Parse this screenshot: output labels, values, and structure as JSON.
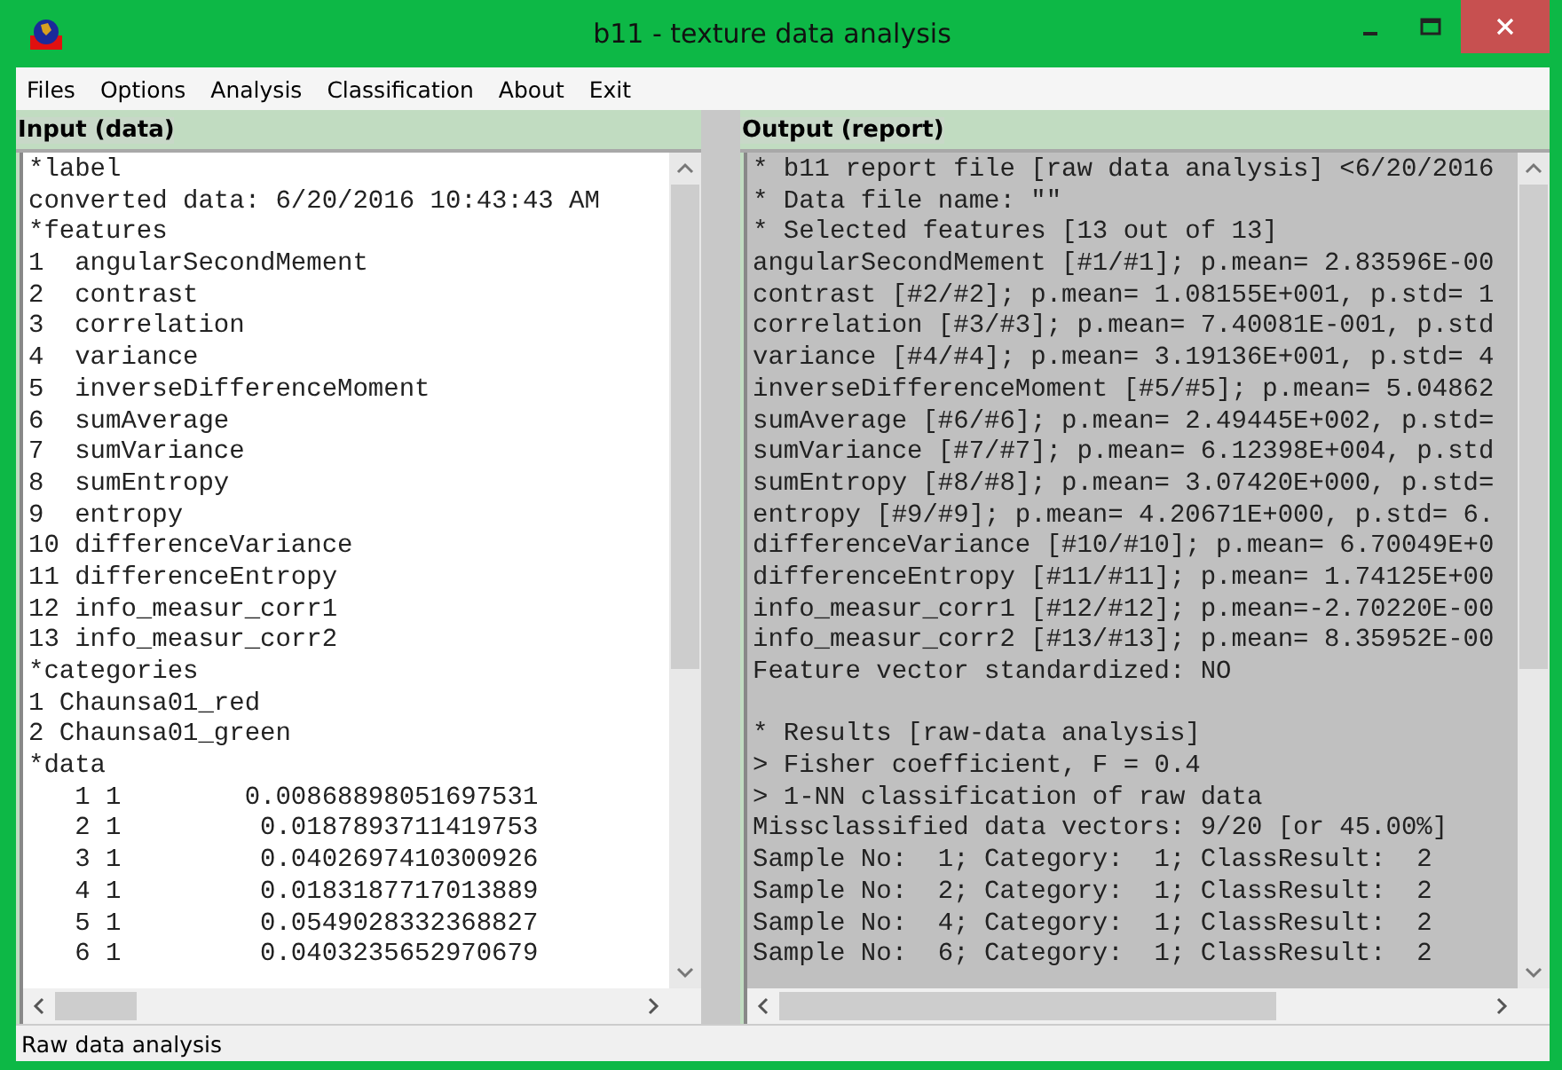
{
  "window": {
    "title": "b11 - texture data analysis"
  },
  "menu": [
    "Files",
    "Options",
    "Analysis",
    "Classification",
    "About",
    "Exit"
  ],
  "input_pane": {
    "title": "Input (data)",
    "lines": [
      "*label",
      "converted data: 6/20/2016 10:43:43 AM",
      "*features",
      "1  angularSecondMement",
      "2  contrast",
      "3  correlation",
      "4  variance",
      "5  inverseDifferenceMoment",
      "6  sumAverage",
      "7  sumVariance",
      "8  sumEntropy",
      "9  entropy",
      "10 differenceVariance",
      "11 differenceEntropy",
      "12 info_measur_corr1",
      "13 info_measur_corr2",
      "*categories",
      "1 Chaunsa01_red",
      "2 Chaunsa01_green",
      "*data",
      "   1 1        0.00868898051697531",
      "   2 1         0.0187893711419753",
      "   3 1         0.0402697410300926",
      "   4 1         0.0183187717013889",
      "   5 1         0.0549028332368827",
      "   6 1         0.0403235652970679"
    ]
  },
  "output_pane": {
    "title": "Output (report)",
    "lines": [
      "* b11 report file [raw data analysis] <6/20/2016",
      "* Data file name: \"\"",
      "* Selected features [13 out of 13]",
      "angularSecondMement [#1/#1]; p.mean= 2.83596E-00",
      "contrast [#2/#2]; p.mean= 1.08155E+001, p.std= 1",
      "correlation [#3/#3]; p.mean= 7.40081E-001, p.std",
      "variance [#4/#4]; p.mean= 3.19136E+001, p.std= 4",
      "inverseDifferenceMoment [#5/#5]; p.mean= 5.04862",
      "sumAverage [#6/#6]; p.mean= 2.49445E+002, p.std=",
      "sumVariance [#7/#7]; p.mean= 6.12398E+004, p.std",
      "sumEntropy [#8/#8]; p.mean= 3.07420E+000, p.std=",
      "entropy [#9/#9]; p.mean= 4.20671E+000, p.std= 6.",
      "differenceVariance [#10/#10]; p.mean= 6.70049E+0",
      "differenceEntropy [#11/#11]; p.mean= 1.74125E+00",
      "info_measur_corr1 [#12/#12]; p.mean=-2.70220E-00",
      "info_measur_corr2 [#13/#13]; p.mean= 8.35952E-00",
      "Feature vector standardized: NO"
    ],
    "results": [
      "* Results [raw-data analysis]",
      "> Fisher coefficient, F = 0.4",
      "> 1-NN classification of raw data",
      "Missclassified data vectors: 9/20 [or 45.00%]",
      "Sample No:  1; Category:  1; ClassResult:  2",
      "Sample No:  2; Category:  1; ClassResult:  2",
      "Sample No:  4; Category:  1; ClassResult:  2",
      "Sample No:  6; Category:  1; ClassResult:  2"
    ]
  },
  "status_bar": "Raw data analysis"
}
